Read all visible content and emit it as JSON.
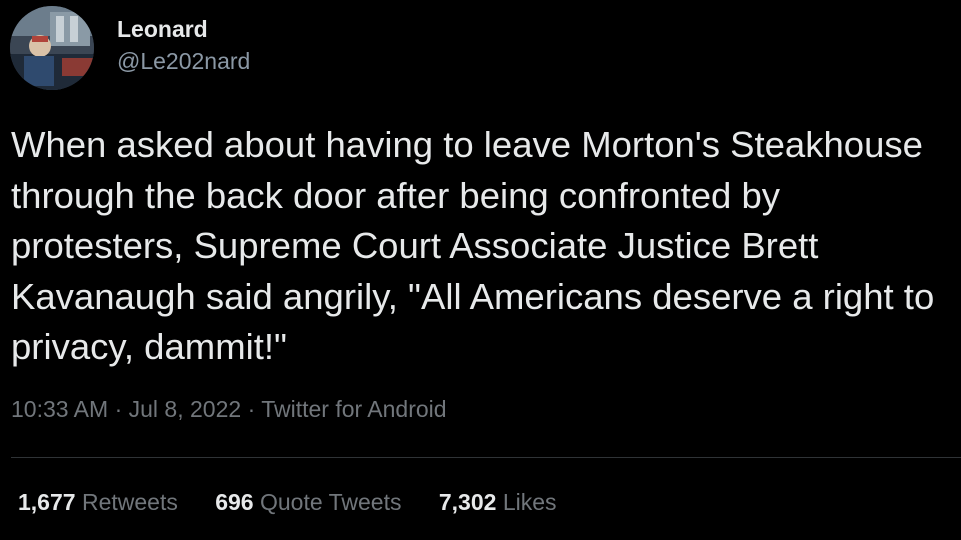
{
  "author": {
    "display_name": "Leonard",
    "handle": "@Le202nard"
  },
  "tweet": {
    "text": "When asked about having to leave Morton's Steakhouse through the back door after being confronted by protesters, Supreme Court Associate Justice Brett Kavanaugh said angrily, \"All Americans deserve a right to privacy, dammit!\"",
    "time": "10:33 AM",
    "separator": "·",
    "date": "Jul 8, 2022",
    "source": "Twitter for Android"
  },
  "stats": [
    {
      "count": "1,677",
      "label": "Retweets"
    },
    {
      "count": "696",
      "label": "Quote Tweets"
    },
    {
      "count": "7,302",
      "label": "Likes"
    }
  ],
  "colors": {
    "background": "#000000",
    "primary_text": "#e7e9ea",
    "secondary_text": "#71767b",
    "divider": "#2f3336"
  }
}
